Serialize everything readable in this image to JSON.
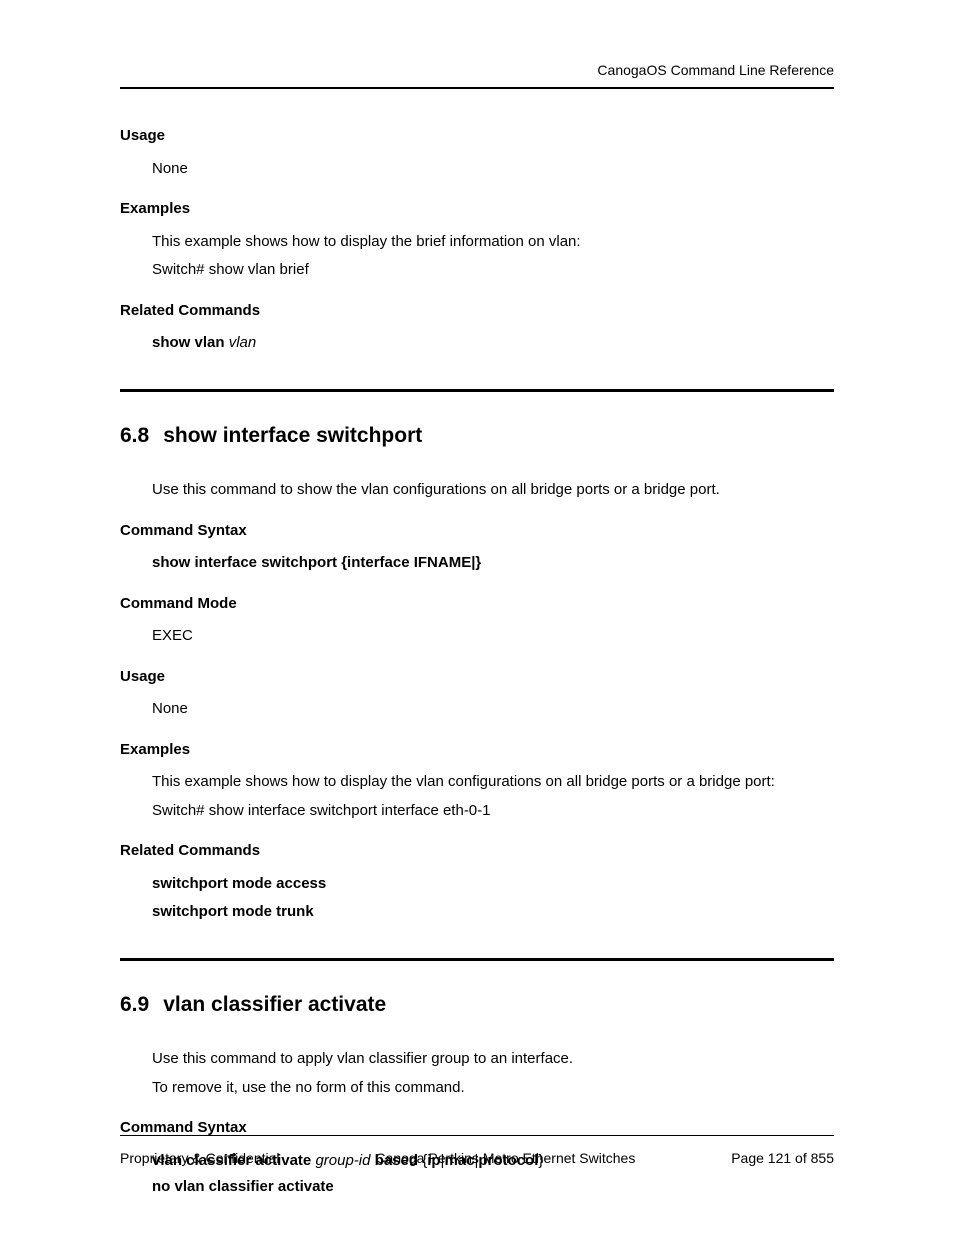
{
  "header": {
    "doc_title": "CanogaOS Command Line Reference"
  },
  "section_prev": {
    "usage_heading": "Usage",
    "usage_text": "None",
    "examples_heading": "Examples",
    "examples_line1": "This example shows how to display the brief information on vlan:",
    "examples_line2": "Switch# show vlan brief",
    "related_heading": "Related Commands",
    "related_cmd_bold": "show vlan",
    "related_cmd_italic": "vlan"
  },
  "section_68": {
    "number": "6.8",
    "title": "show interface switchport",
    "intro": "Use this command to show the vlan configurations on all bridge ports or a bridge port.",
    "syntax_heading": "Command Syntax",
    "syntax_text": "show interface switchport {interface IFNAME|}",
    "mode_heading": "Command Mode",
    "mode_text": "EXEC",
    "usage_heading": "Usage",
    "usage_text": "None",
    "examples_heading": "Examples",
    "examples_line1": "This example shows how to display the vlan configurations on all bridge ports or a bridge port:",
    "examples_line2": "Switch# show interface switchport interface eth-0-1",
    "related_heading": "Related Commands",
    "related_cmd1": "switchport mode access",
    "related_cmd2": "switchport mode trunk"
  },
  "section_69": {
    "number": "6.9",
    "title": "vlan classifier activate",
    "intro_line1": "Use this command to apply vlan classifier group to an interface.",
    "intro_line2": "To remove it, use the no form of this command.",
    "syntax_heading": "Command Syntax",
    "syntax1_part1": "vlan classifier activate",
    "syntax1_part2": "group-id",
    "syntax1_part3": "based",
    "syntax1_part4a": "ip",
    "syntax1_part4b": "mac",
    "syntax1_part4c": "protocol",
    "syntax2": "no vlan classifier activate"
  },
  "footer": {
    "left": "Proprietary & Confidential",
    "center": "Canoga Pertkins Metro Ethernet Switches",
    "right": "Page 121 of 855"
  }
}
